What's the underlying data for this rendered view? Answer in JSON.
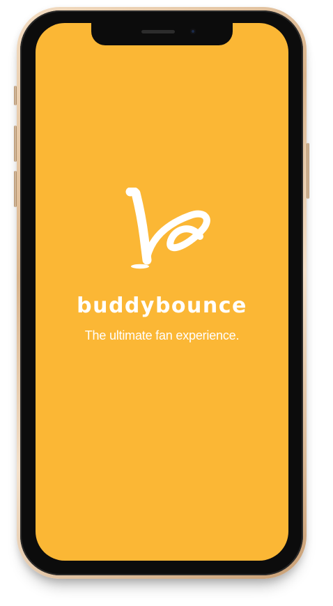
{
  "splash": {
    "brand_name": "buddybounce",
    "tagline": "The ultimate fan experience.",
    "logo_icon": "buddybounce-logo-icon"
  },
  "colors": {
    "background": "#fbb735",
    "text": "#ffffff",
    "phone_frame": "#e8c9a6",
    "bezel": "#0c0c0c"
  }
}
